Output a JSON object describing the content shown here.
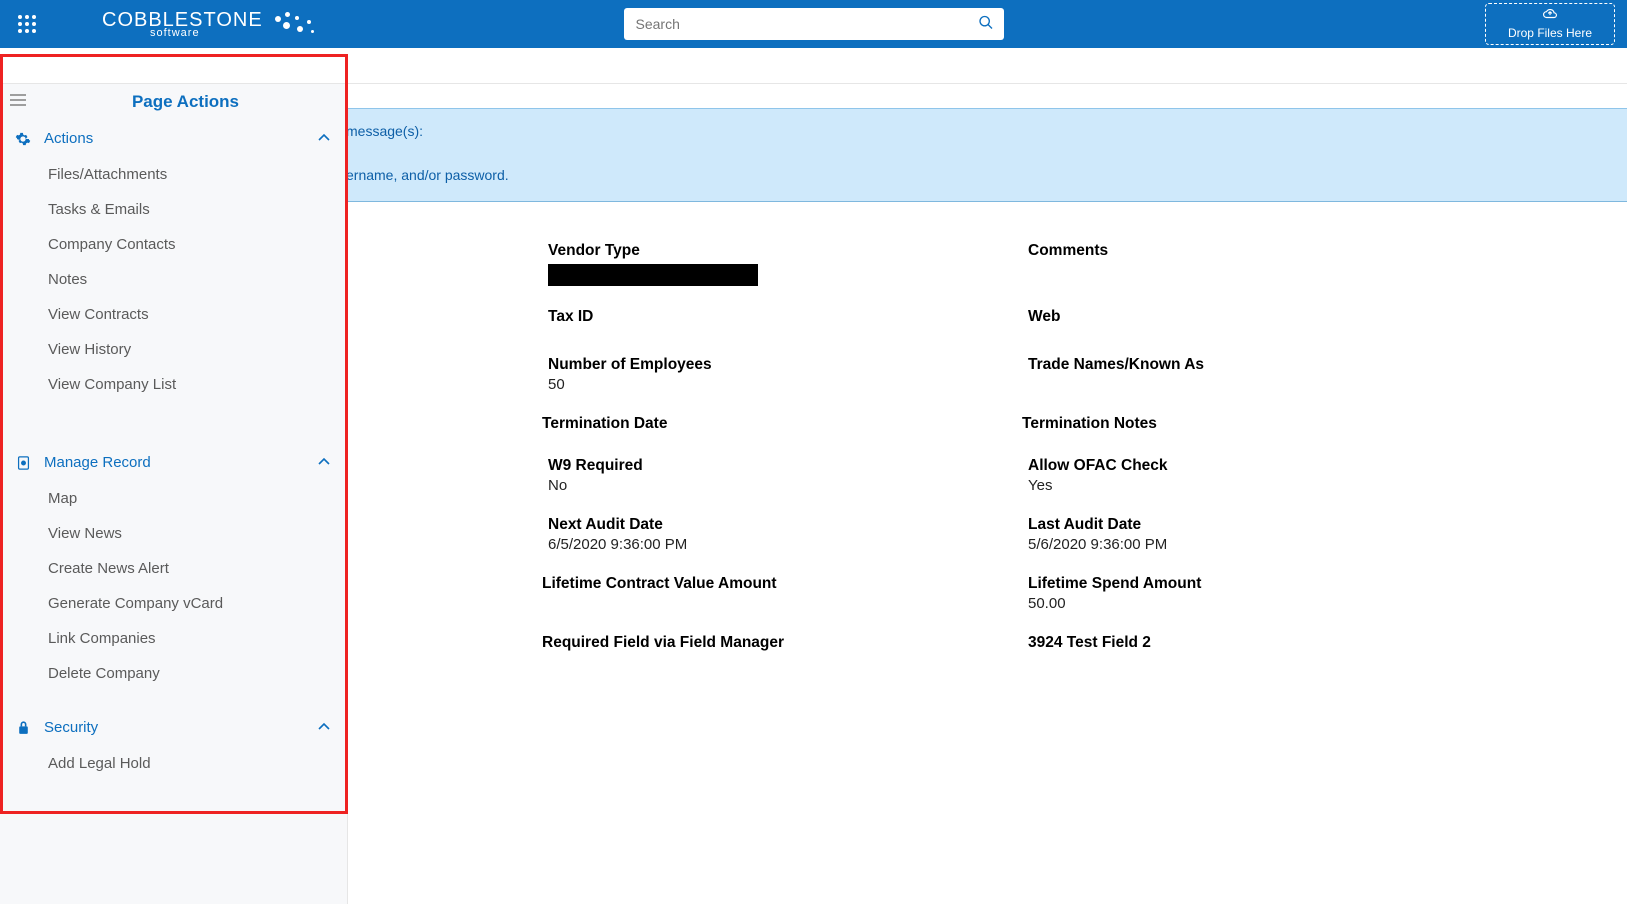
{
  "header": {
    "brand_main": "COBBLESTONE",
    "brand_sub": "software",
    "search_placeholder": "Search",
    "dropzone_label": "Drop Files Here"
  },
  "sidebar": {
    "title": "Page Actions",
    "sections": [
      {
        "label": "Actions",
        "items": [
          "Files/Attachments",
          "Tasks & Emails",
          "Company Contacts",
          "Notes",
          "View Contracts",
          "View History",
          "View Company List"
        ]
      },
      {
        "label": "Manage Record",
        "items": [
          "Map",
          "View News",
          "Create News Alert",
          "Generate Company vCard",
          "Link Companies",
          "Delete Company"
        ]
      },
      {
        "label": "Security",
        "items": [
          "Add Legal Hold"
        ]
      }
    ]
  },
  "alert": {
    "line1": "message(s):",
    "line2": "ername, and/or password."
  },
  "fields": {
    "rows": [
      {
        "left_label": "Vendor Type",
        "left_value": "",
        "left_redacted": true,
        "right_label": "Comments",
        "right_value": ""
      },
      {
        "left_label": "Tax ID",
        "left_value": "",
        "right_label": "Web",
        "right_value": ""
      },
      {
        "left_label": "Number of Employees",
        "left_value": "50",
        "right_label": "Trade Names/Known As",
        "right_value": ""
      },
      {
        "left_label": "Termination Date",
        "left_value": "",
        "right_label": "Termination Notes",
        "right_value": ""
      },
      {
        "left_label": "W9 Required",
        "left_value": "No",
        "right_label": "Allow OFAC Check",
        "right_value": "Yes"
      },
      {
        "left_label": "Next Audit Date",
        "left_value": "6/5/2020 9:36:00 PM",
        "right_label": "Last Audit Date",
        "right_value": "5/6/2020 9:36:00 PM"
      },
      {
        "left_label": "Lifetime Contract Value Amount",
        "left_value": "",
        "right_label": "Lifetime Spend Amount",
        "right_value": "50.00"
      },
      {
        "left_label": "Required Field via Field Manager",
        "left_value": "",
        "right_label": "3924 Test Field 2",
        "right_value": ""
      }
    ]
  }
}
